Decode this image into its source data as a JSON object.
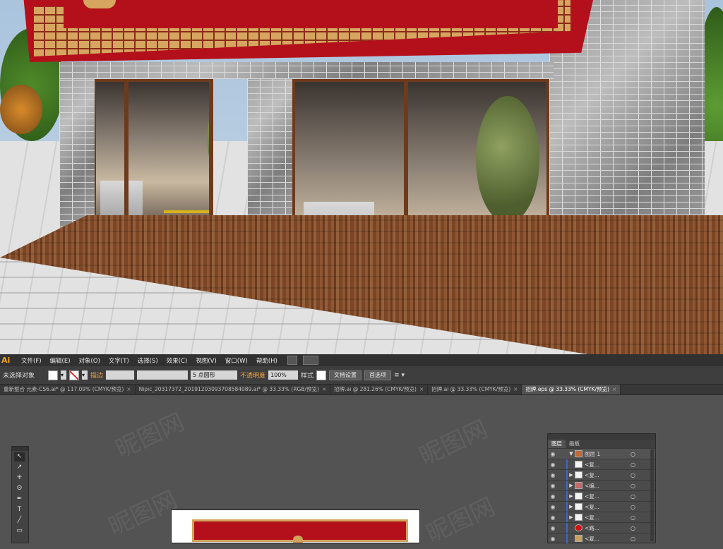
{
  "menubar": {
    "logo": "Ai",
    "items": [
      "文件(F)",
      "编辑(E)",
      "对象(O)",
      "文字(T)",
      "选择(S)",
      "效果(C)",
      "视图(V)",
      "窗口(W)",
      "帮助(H)"
    ]
  },
  "control_bar": {
    "selection_status": "未选择对象",
    "stroke_label": "描边",
    "brush_value": "5 点圆形",
    "opacity_label": "不透明度",
    "opacity_value": "100%",
    "style_label": "样式",
    "doc_setup_button": "文档设置",
    "preferences_button": "首选项"
  },
  "doc_tabs": [
    {
      "label": "重新整合 元素-CS6.ai* @ 117.09% (CMYK/预览)",
      "active": false
    },
    {
      "label": "Nipic_20317372_20191203093708584089.ai* @ 33.33% (RGB/预览)",
      "active": false
    },
    {
      "label": "招牌.ai @ 281.26% (CMYK/预览)",
      "active": false
    },
    {
      "label": "招牌.ai @ 33.33% (CMYK/预览)",
      "active": false
    },
    {
      "label": "招牌.eps @ 33.33% (CMYK/预览)",
      "active": true
    }
  ],
  "layers_panel": {
    "tabs": [
      "图层",
      "画板"
    ],
    "rows": [
      {
        "name": "图层 1",
        "expanded": true
      },
      {
        "name": "<复...",
        "expanded": false
      },
      {
        "name": "<复...",
        "expanded": false
      },
      {
        "name": "<编...",
        "expanded": false
      },
      {
        "name": "<复...",
        "expanded": false
      },
      {
        "name": "<复...",
        "expanded": false
      },
      {
        "name": "<复...",
        "expanded": false
      },
      {
        "name": "<路...",
        "expanded": false
      },
      {
        "name": "<复...",
        "expanded": false
      }
    ]
  },
  "colors": {
    "accent": "#f7a51c",
    "sign_red": "#b4101c",
    "layer_bar": "#3a64d6"
  },
  "watermark": "昵图网"
}
